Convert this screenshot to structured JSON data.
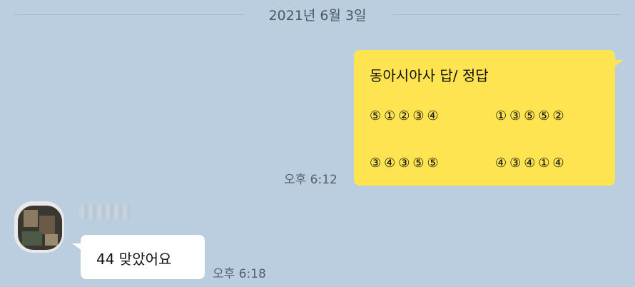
{
  "date_divider": "2021년 6월 3일",
  "my_message": {
    "title": "동아시아사 답/ 정답",
    "row1_group1": "⑤①②③④",
    "row1_group2": "①③⑤⑤②",
    "row2_group1": "③④③⑤⑤",
    "row2_group2": "④③④①④",
    "time": "오후 6:12"
  },
  "other_message": {
    "sender_name": "",
    "text": "44 맞았어요",
    "time": "오후 6:18"
  },
  "colors": {
    "background": "#bacee0",
    "my_bubble": "#fee451",
    "other_bubble": "#ffffff"
  }
}
